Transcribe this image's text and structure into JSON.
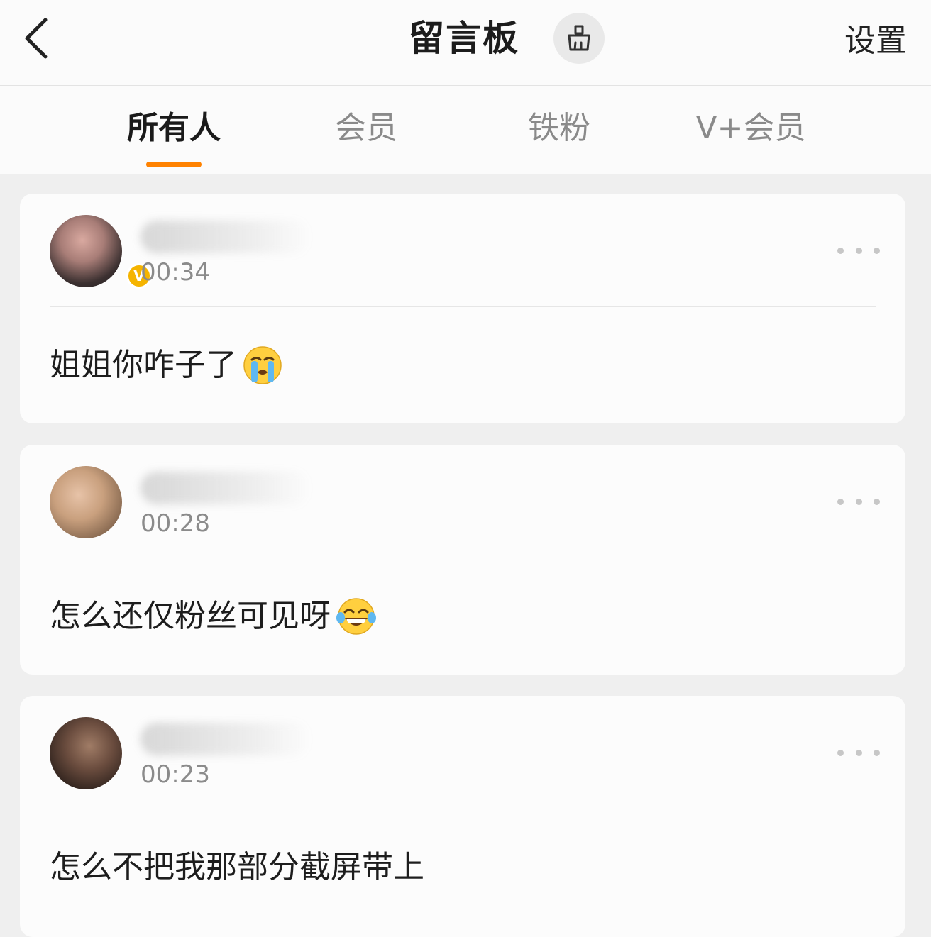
{
  "header": {
    "title": "留言板",
    "settings_label": "设置"
  },
  "tabs": [
    {
      "label": "所有人",
      "active": true
    },
    {
      "label": "会员",
      "active": false
    },
    {
      "label": "铁粉",
      "active": false
    },
    {
      "label": "V+会员",
      "active": false
    }
  ],
  "colors": {
    "accent": "#ff8200",
    "verified": "#f5b400"
  },
  "messages": [
    {
      "time": "00:34",
      "text": "姐姐你咋子了",
      "emoji": "loudly-crying-emoji",
      "verified": true
    },
    {
      "time": "00:28",
      "text": "怎么还仅粉丝可见呀",
      "emoji": "tears-of-joy-emoji",
      "verified": false
    },
    {
      "time": "00:23",
      "text": "怎么不把我那部分截屏带上",
      "emoji": null,
      "verified": false
    }
  ]
}
